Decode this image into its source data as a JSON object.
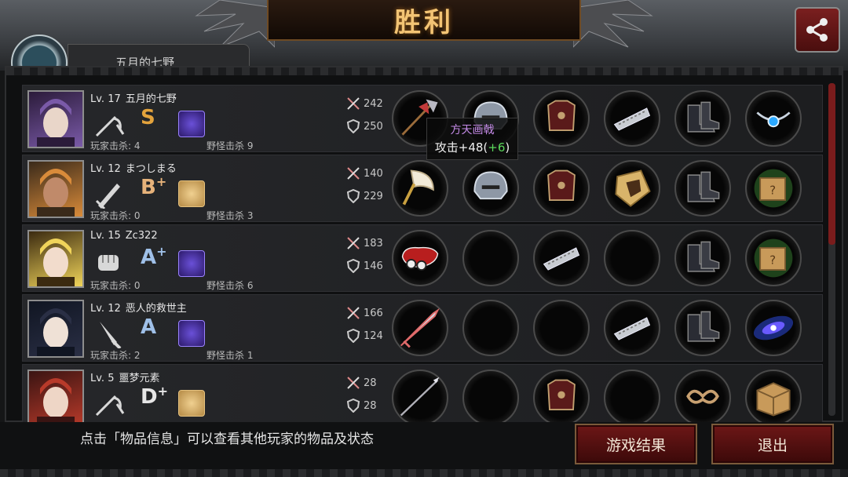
{
  "title": "胜利",
  "top_name_partial": "五月的七野",
  "players": [
    {
      "level": "Lv. 17",
      "name": "五月的七野",
      "grade": "S",
      "grade_plus": "",
      "card": "purple",
      "pk_label": "玩家击杀: 4",
      "mk_label": "野怪击杀 9",
      "atk": "242",
      "def": "250",
      "weapon_icon": "rapier-icon",
      "slots": [
        "halberd-icon",
        "helmet-icon",
        "armor-icon",
        "bracer-icon",
        "boots-icon",
        "necklace-icon"
      ]
    },
    {
      "level": "Lv. 12",
      "name": "まつしまる",
      "grade": "B",
      "grade_plus": "+",
      "card": "gold",
      "pk_label": "玩家击杀: 0",
      "mk_label": "野怪击杀 3",
      "atk": "140",
      "def": "229",
      "weapon_icon": "sword-icon",
      "slots": [
        "axe-icon",
        "helmet-icon",
        "armor-icon",
        "shield-icon",
        "boots-icon",
        "mystery-box-icon"
      ]
    },
    {
      "level": "Lv. 15",
      "name": "Zc322",
      "grade": "A",
      "grade_plus": "+",
      "card": "purple",
      "pk_label": "玩家击杀: 0",
      "mk_label": "野怪击杀 6",
      "atk": "183",
      "def": "146",
      "weapon_icon": "fist-icon",
      "slots": [
        "glove-icon",
        "empty",
        "bracer-icon",
        "empty",
        "boots-icon",
        "mystery-box-icon"
      ]
    },
    {
      "level": "Lv. 12",
      "name": "恶人的救世主",
      "grade": "A",
      "grade_plus": "",
      "card": "purple",
      "pk_label": "玩家击杀: 2",
      "mk_label": "野怪击杀 1",
      "atk": "166",
      "def": "124",
      "weapon_icon": "dagger-icon",
      "slots": [
        "blade-icon",
        "empty",
        "empty",
        "bracer-icon",
        "boots-icon",
        "galaxy-icon"
      ]
    },
    {
      "level": "Lv. 5",
      "name": "噩梦元素",
      "grade": "D",
      "grade_plus": "+",
      "card": "gold",
      "pk_label": "",
      "mk_label": "",
      "atk": "28",
      "def": "28",
      "weapon_icon": "rapier-icon",
      "slots": [
        "spear-icon",
        "empty",
        "armor-icon",
        "empty",
        "ring-icon",
        "box-icon"
      ]
    }
  ],
  "tooltip": {
    "name": "方天画戟",
    "value": "攻击+48(",
    "plus": "+6",
    "close": ")"
  },
  "hint": "点击「物品信息」可以查看其他玩家的物品及状态",
  "buttons": {
    "result": "游戏结果",
    "exit": "退出"
  },
  "colors": {
    "accent_gold": "#f3c474",
    "button_red": "#6d1717",
    "grade_S": "#e3a33c",
    "grade_B": "#e6b27a",
    "grade_A": "#9fc0e8",
    "grade_D": "#e6e6e6"
  }
}
